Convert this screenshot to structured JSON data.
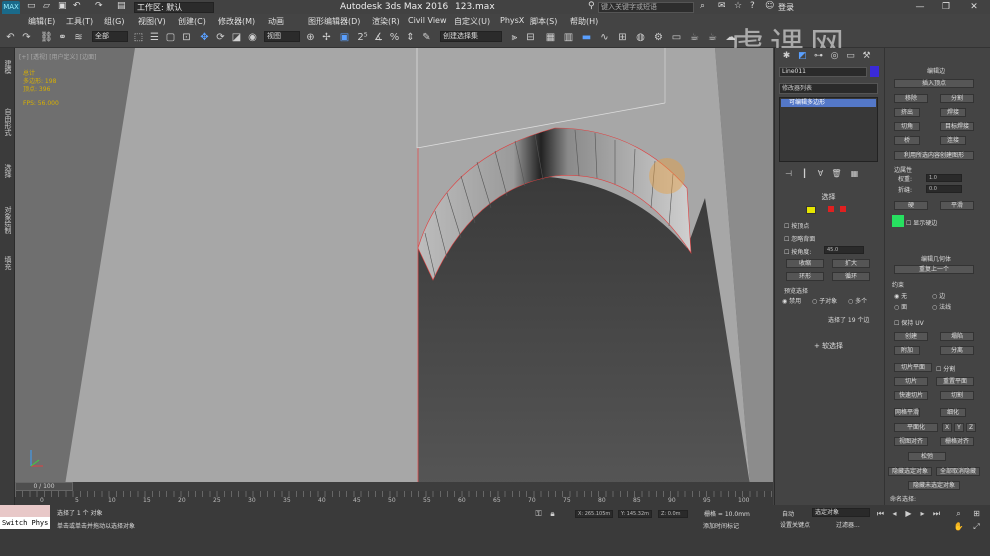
{
  "window": {
    "app_title": "Autodesk 3ds Max 2016",
    "file_name": "123.max",
    "workspace": "工作区: 默认",
    "search_placeholder": "键入关键字或短语",
    "login": "登录",
    "max_logo": "MAX"
  },
  "menu": [
    "编辑(E)",
    "工具(T)",
    "组(G)",
    "视图(V)",
    "创建(C)",
    "修改器(M)",
    "动画",
    "图形编辑器(D)",
    "渲染(R)",
    "Civil View",
    "自定义(U)",
    "PhysX",
    "脚本(S)",
    "帮助(H)"
  ],
  "toolbar": {
    "filter_dropdown": "全部",
    "view_dropdown": "视图",
    "selection_set": "创建选择集"
  },
  "side_tabs": [
    "建模",
    "自由形式",
    "选择",
    "对象绘制",
    "填充"
  ],
  "viewport": {
    "label": "[+] [透视] [用户定义] [边面]",
    "stats": [
      "总计",
      "多边形: 198",
      "顶点: 396",
      "FPS: 56.000"
    ]
  },
  "timeline": {
    "slider": "0 / 100",
    "ticks": [
      "0",
      "5",
      "10",
      "15",
      "20",
      "25",
      "30",
      "35",
      "40",
      "45",
      "50",
      "55",
      "60",
      "65",
      "70",
      "75",
      "80",
      "85",
      "90",
      "95",
      "100"
    ]
  },
  "status": {
    "script_label": "Switch Phys",
    "line1": "选择了 1 个 对象",
    "line2": "单击或单击并拖动以选择对象",
    "x": "X: 265.105m",
    "y": "Y: 145.32m",
    "z": "Z: 0.0m",
    "grid": "栅格 = 10.0mm",
    "add_time_tag": "添加时间标记",
    "auto": "自动",
    "selection_dropdown": "选定对象",
    "set_key": "设置关键点",
    "filters": "过滤器..."
  },
  "command_panel": {
    "object_name": "Line011",
    "object_color": "#3a2ad8",
    "modifier_list": "修改器列表",
    "stack_item": "可编辑多边形",
    "selection_title": "选择",
    "by_vertex": "按顶点",
    "ignore_backfacing": "忽略背面",
    "by_angle": "按角度:",
    "angle_value": "45.0",
    "shrink": "收缩",
    "grow": "扩大",
    "ring": "环形",
    "loop": "循环",
    "preview_selection": "预览选择",
    "preview_options": [
      "禁用",
      "子对象",
      "多个"
    ],
    "selected_count": "选择了 19 个边",
    "soft_selection": "软选择"
  },
  "rollout": {
    "edit_edges_title": "编辑边",
    "insert_vertex": "插入顶点",
    "remove": "移除",
    "split": "分割",
    "extrude": "挤出",
    "weld": "焊接",
    "chamfer": "切角",
    "target_weld": "目标焊接",
    "bridge": "桥",
    "connect": "连接",
    "create_shape": "利用所选内容创建图形",
    "weight_label": "边属性",
    "weight": "权重:",
    "weight_val": "1.0",
    "crease": "折缝:",
    "crease_val": "0.0",
    "hard": "硬",
    "smooth": "平滑",
    "show_hard_edges": "显示硬边",
    "hard_edge_color": "#27e060",
    "edit_geometry_title": "编辑几何体",
    "repeat_last": "重复上一个",
    "constraints": "约束",
    "constraint_options": [
      "无",
      "边",
      "面",
      "法线"
    ],
    "preserve_uvs": "保持 UV",
    "create": "创建",
    "collapse": "塌陷",
    "attach": "附加",
    "detach": "分离",
    "slice_plane": "切片平面",
    "split_check": "分割",
    "slice": "切片",
    "reset_plane": "重置平面",
    "quickslice": "快速切片",
    "cut": "切割",
    "meshsmooth": "网格平滑",
    "tessellate": "细化",
    "make_planar": "平面化",
    "x": "X",
    "y": "Y",
    "z": "Z",
    "view_align": "视图对齐",
    "grid_align": "栅格对齐",
    "relax": "松弛",
    "hide_selected": "隐藏选定对象",
    "unhide_all": "全部取消隐藏",
    "hide_unselected": "隐藏未选定对象",
    "named_selections": "命名选择:"
  },
  "watermark": "虎课网"
}
